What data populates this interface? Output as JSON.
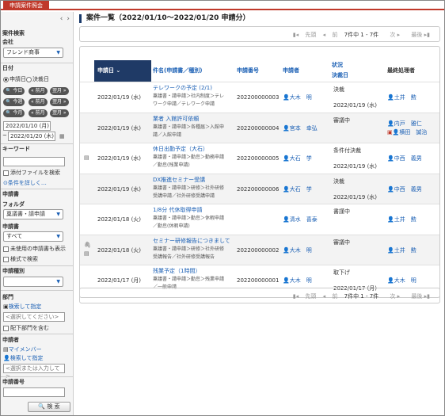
{
  "app": {
    "tab": "申請案件照会"
  },
  "sidebar": {
    "nav_prev": "‹",
    "nav_next": "›",
    "section_title": "案件検索",
    "company_label": "会社",
    "company_value": "フレンド商事",
    "date_label": "日付",
    "date_opt1": "申請日",
    "date_opt2": "決裁日",
    "pills_row1": [
      "今日",
      "前月",
      "翌月"
    ],
    "pills_row2": [
      "今週",
      "前月",
      "翌月"
    ],
    "pills_row3": [
      "今月",
      "前月",
      "翌月"
    ],
    "date_from": "2022/01/10 (月)",
    "date_tilde": "~",
    "date_to": "2022/01/20 (木)",
    "keyword_label": "キーワード",
    "attach_label": "添付ファイルを検索",
    "more_label": "⊙条件を詳しく…",
    "applicant_section": "申請書",
    "folder_label": "フォルダ",
    "folder_value": "稟議書・請申請",
    "form_label": "申請書",
    "form_value": "すべて",
    "unused_label": "未使用の申請書も表示",
    "format_label": "様式で検索",
    "kind_label": "申請種別",
    "dept_label": "部門",
    "dept_search": "検索して指定",
    "dept_placeholder": "<選択してください>",
    "dept_sub_label": "配下部門を含む",
    "applicant_label": "申請者",
    "my_member": "マイメンバー",
    "applicant_search": "検索して指定",
    "applicant_placeholder": "<選択または入力して>",
    "number_label": "申請番号",
    "search_button": "検 索"
  },
  "main": {
    "title": "案件一覧（2022/01/10～2022/01/20 申請分）",
    "pager": {
      "first": "先頭",
      "prev": "前",
      "count": "7件中 1 - 7件",
      "next": "次",
      "last": "最後"
    },
    "headers": {
      "date": "申請日",
      "title": "件名(申請書／種別)",
      "number": "申請番号",
      "applicant": "申請者",
      "status": "状況",
      "decided": "決裁日",
      "handler": "最終処理者"
    },
    "rows": [
      {
        "date": "2022/01/19 (水)",
        "title": "テレワークの予定 (2/1)",
        "sub1": "稟議書・請申請＞社内制度＞テレ",
        "sub2": "ワーク申請／テレワーク申請",
        "number": "202200000003",
        "applicant": "大木　明",
        "status": "決裁",
        "decided": "2022/01/19 (水)",
        "handler": "土井　勲",
        "handler2": "",
        "icon": ""
      },
      {
        "date": "2022/01/19 (水)",
        "title": "業者 入館許可依頼",
        "sub1": "稟議書・請申請＞各種届＞入館申",
        "sub2": "請／入館申請",
        "number": "202200000004",
        "applicant": "宮本　幸弘",
        "status": "審議中",
        "decided": "",
        "handler": "内戸　雅仁",
        "handler2": "横田　誠治",
        "icon": ""
      },
      {
        "date": "2022/01/19 (水)",
        "title": "休日出勤予定（大石）",
        "sub1": "稟議書・請申請＞勤怠＞勤務申請",
        "sub2": "／勤怠(残業申請)",
        "number": "202200000005",
        "applicant": "大石　学",
        "status": "条件付決裁",
        "decided": "2022/01/19 (水)",
        "handler": "中西　義男",
        "handler2": "",
        "icon": "memo"
      },
      {
        "date": "2022/01/19 (水)",
        "title": "DX推進セミナー受講",
        "sub1": "稟議書・請申請＞研修＞社外研修",
        "sub2": "受講申請／社外研修受講申請",
        "number": "202200000006",
        "applicant": "大石　学",
        "status": "決裁",
        "decided": "2022/01/19 (水)",
        "handler": "中西　義男",
        "handler2": "",
        "icon": ""
      },
      {
        "date": "2022/01/18 (火)",
        "title": "1/8分 代休取得申請",
        "sub1": "稟議書・請申請＞勤怠＞休暇申請",
        "sub2": "／勤怠(休暇申請)",
        "number": "",
        "applicant": "清水　喜泰",
        "status": "書謹中",
        "decided": "",
        "handler": "土井　勲",
        "handler2": "",
        "icon": ""
      },
      {
        "date": "2022/01/18 (火)",
        "title": "セミナー研修報告につきまして",
        "sub1": "稟議書・請申請＞研修＞社外研修",
        "sub2": "受講報告／社外研修受講報告",
        "number": "202200000002",
        "applicant": "大木　明",
        "status": "審議中",
        "decided": "",
        "handler": "土井　勲",
        "handler2": "",
        "icon": "clip"
      },
      {
        "date": "2022/01/17 (月)",
        "title": "残業予定（1時間）",
        "sub1": "稟議書・請申請＞勤怠＞残業申請",
        "sub2": "／一般申請",
        "number": "202200000001",
        "applicant": "大木　明",
        "status": "取下げ",
        "decided": "2022/01/17 (月)",
        "handler": "大木　明",
        "handler2": "",
        "icon": ""
      }
    ]
  }
}
